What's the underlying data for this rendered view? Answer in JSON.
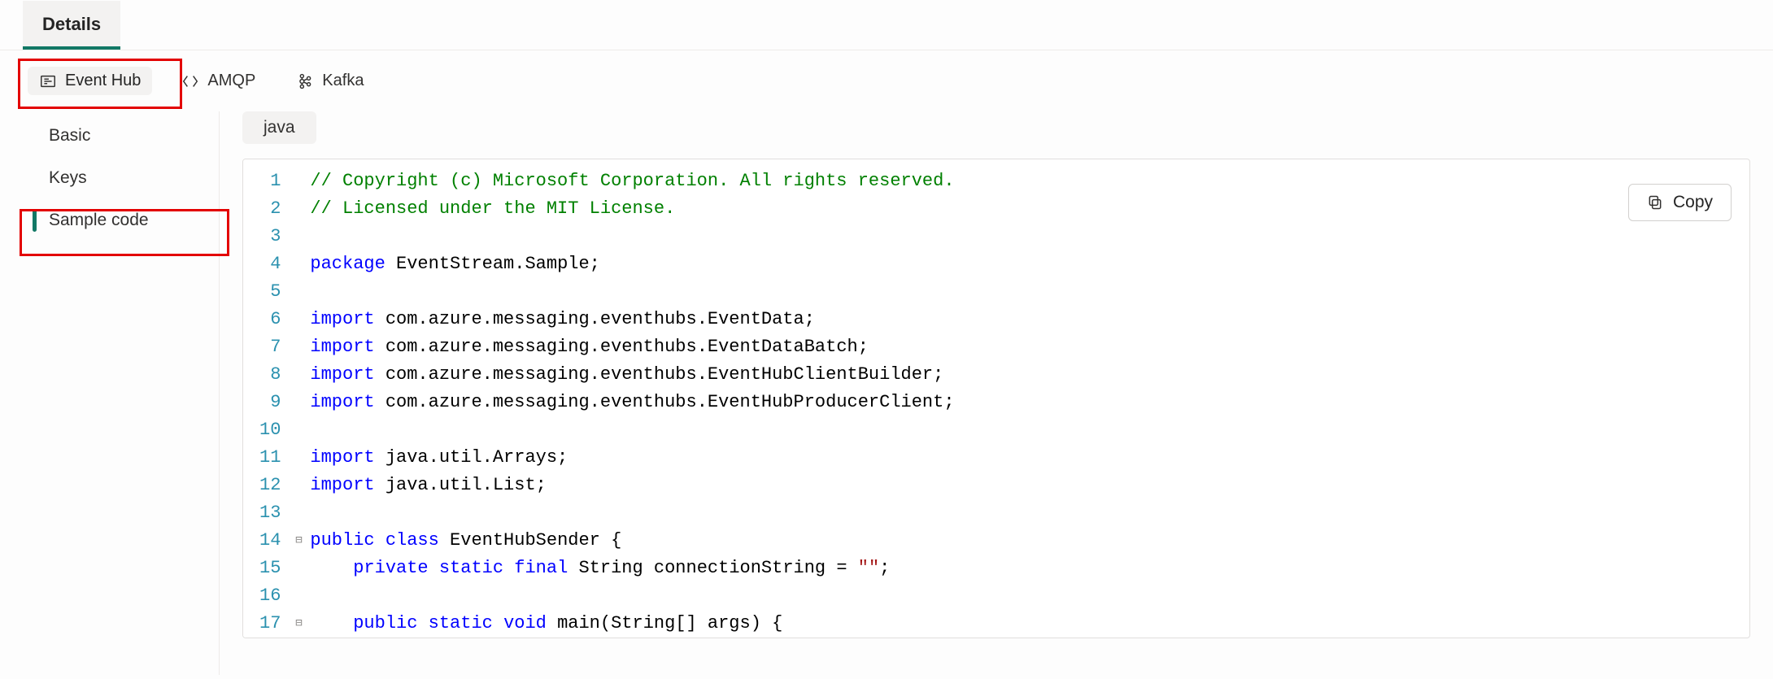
{
  "top_tab": {
    "details": "Details"
  },
  "protocols": {
    "event_hub": "Event Hub",
    "amqp": "AMQP",
    "kafka": "Kafka"
  },
  "sidebar": {
    "items": [
      {
        "label": "Basic"
      },
      {
        "label": "Keys"
      },
      {
        "label": "Sample code"
      }
    ]
  },
  "content": {
    "language_chip": "java",
    "copy_label": "Copy"
  },
  "code": {
    "line_numbers": [
      "1",
      "2",
      "3",
      "4",
      "5",
      "6",
      "7",
      "8",
      "9",
      "10",
      "11",
      "12",
      "13",
      "14",
      "15",
      "16",
      "17"
    ],
    "fold_markers": {
      "14": "⊟",
      "17": "⊟"
    },
    "lines": [
      [
        [
          "c",
          "// Copyright (c) Microsoft Corporation. All rights reserved."
        ]
      ],
      [
        [
          "c",
          "// Licensed under the MIT License."
        ]
      ],
      [],
      [
        [
          "kw",
          "package"
        ],
        [
          "id",
          " EventStream.Sample;"
        ]
      ],
      [],
      [
        [
          "kw",
          "import"
        ],
        [
          "id",
          " com.azure.messaging.eventhubs.EventData;"
        ]
      ],
      [
        [
          "kw",
          "import"
        ],
        [
          "id",
          " com.azure.messaging.eventhubs.EventDataBatch;"
        ]
      ],
      [
        [
          "kw",
          "import"
        ],
        [
          "id",
          " com.azure.messaging.eventhubs.EventHubClientBuilder;"
        ]
      ],
      [
        [
          "kw",
          "import"
        ],
        [
          "id",
          " com.azure.messaging.eventhubs.EventHubProducerClient;"
        ]
      ],
      [],
      [
        [
          "kw",
          "import"
        ],
        [
          "id",
          " java.util.Arrays;"
        ]
      ],
      [
        [
          "kw",
          "import"
        ],
        [
          "id",
          " java.util.List;"
        ]
      ],
      [],
      [
        [
          "kw",
          "public"
        ],
        [
          "id",
          " "
        ],
        [
          "kw",
          "class"
        ],
        [
          "id",
          " EventHubSender {"
        ]
      ],
      [
        [
          "id",
          "    "
        ],
        [
          "kw",
          "private"
        ],
        [
          "id",
          " "
        ],
        [
          "kw",
          "static"
        ],
        [
          "id",
          " "
        ],
        [
          "kw",
          "final"
        ],
        [
          "id",
          " String connectionString = "
        ],
        [
          "str",
          "\"\""
        ],
        [
          "id",
          ";"
        ]
      ],
      [],
      [
        [
          "id",
          "    "
        ],
        [
          "kw",
          "public"
        ],
        [
          "id",
          " "
        ],
        [
          "kw",
          "static"
        ],
        [
          "id",
          " "
        ],
        [
          "kw",
          "void"
        ],
        [
          "id",
          " main(String[] args) {"
        ]
      ]
    ]
  }
}
